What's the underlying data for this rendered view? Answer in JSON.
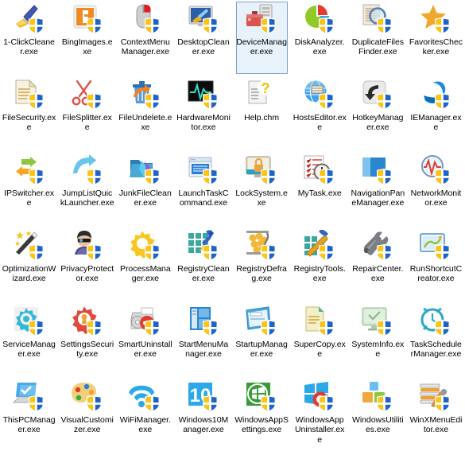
{
  "window": {
    "view": "large-icons-file-grid",
    "background_color": "#ffffff",
    "label_color": "#000000",
    "selection_border_color": "#7da2ce",
    "selection_fill_color": "#e8f2fb",
    "columns": 8,
    "rows": 6,
    "item_count": 48
  },
  "items": [
    {
      "name": "1-ClickCleaner.exe",
      "icon": "broom-brush-icon",
      "shield": true
    },
    {
      "name": "BingImages.exe",
      "icon": "bing-b-icon",
      "shield": true
    },
    {
      "name": "ContextMenuManager.exe",
      "icon": "mouse-icon",
      "shield": true
    },
    {
      "name": "DesktopCleaner.exe",
      "icon": "desktop-broom-icon",
      "shield": true
    },
    {
      "name": "DeviceManager.exe",
      "icon": "toolbox-device-icon",
      "shield": true,
      "selected": true
    },
    {
      "name": "DiskAnalyzer.exe",
      "icon": "pie-chart-icon",
      "shield": true
    },
    {
      "name": "DuplicateFilesFinder.exe",
      "icon": "documents-magnifier-icon",
      "shield": true
    },
    {
      "name": "FavoritesChecker.exe",
      "icon": "star-icon",
      "shield": true
    },
    {
      "name": "FileSecurity.exe",
      "icon": "document-lines-icon",
      "shield": true
    },
    {
      "name": "FileSplitter.exe",
      "icon": "scissors-icon",
      "shield": true
    },
    {
      "name": "FileUndelete.exe",
      "icon": "trash-undo-icon",
      "shield": true
    },
    {
      "name": "HardwareMonitor.exe",
      "icon": "heartbeat-screen-icon",
      "shield": true
    },
    {
      "name": "Help.chm",
      "icon": "help-question-document-icon",
      "shield": false
    },
    {
      "name": "HostsEditor.exe",
      "icon": "globe-hosts-icon",
      "shield": true
    },
    {
      "name": "HotkeyManager.exe",
      "icon": "hotkey-arrow-icon",
      "shield": true
    },
    {
      "name": "IEManager.exe",
      "icon": "internet-explorer-e-icon",
      "shield": true
    },
    {
      "name": "IPSwitcher.exe",
      "icon": "two-arrows-swap-icon",
      "shield": true
    },
    {
      "name": "JumpListQuickLauncher.exe",
      "icon": "curved-arrow-icon",
      "shield": true
    },
    {
      "name": "JunkFileCleaner.exe",
      "icon": "folder-junk-icon",
      "shield": true
    },
    {
      "name": "LaunchTaskCommand.exe",
      "icon": "window-panel-icon",
      "shield": true
    },
    {
      "name": "LockSystem.exe",
      "icon": "monitor-lock-icon",
      "shield": true
    },
    {
      "name": "MyTask.exe",
      "icon": "checklist-clock-icon",
      "shield": true
    },
    {
      "name": "NavigationPaneManager.exe",
      "icon": "nav-pane-icon",
      "shield": true
    },
    {
      "name": "NetworkMonitor.exe",
      "icon": "network-pulse-icon",
      "shield": true
    },
    {
      "name": "OptimizationWizard.exe",
      "icon": "magic-wand-icon",
      "shield": true
    },
    {
      "name": "PrivacyProtector.exe",
      "icon": "spy-person-icon",
      "shield": true
    },
    {
      "name": "ProcessManager.exe",
      "icon": "yellow-gear-icon",
      "shield": true
    },
    {
      "name": "RegistryCleaner.exe",
      "icon": "registry-grid-brush-icon",
      "shield": true
    },
    {
      "name": "RegistryDefrag.exe",
      "icon": "registry-compress-icon",
      "shield": true
    },
    {
      "name": "RegistryTools.exe",
      "icon": "registry-wrench-icon",
      "shield": true
    },
    {
      "name": "RepairCenter.exe",
      "icon": "screwdriver-wrench-icon",
      "shield": true
    },
    {
      "name": "RunShortcutCreator.exe",
      "icon": "shortcut-frame-icon",
      "shield": true
    },
    {
      "name": "ServiceManager.exe",
      "icon": "cyan-gear-icon",
      "shield": true
    },
    {
      "name": "SettingsSecurity.exe",
      "icon": "red-gear-lock-icon",
      "shield": true
    },
    {
      "name": "SmartUninstaller.exe",
      "icon": "uninstall-disc-icon",
      "shield": true
    },
    {
      "name": "StartMenuManager.exe",
      "icon": "start-menu-panel-icon",
      "shield": true
    },
    {
      "name": "StartupManager.exe",
      "icon": "startup-window-icon",
      "shield": true
    },
    {
      "name": "SuperCopy.exe",
      "icon": "copy-pages-icon",
      "shield": true
    },
    {
      "name": "SystemInfo.exe",
      "icon": "monitor-check-icon",
      "shield": true
    },
    {
      "name": "TaskSchedulerManager.exe",
      "icon": "alarm-clock-icon",
      "shield": true
    },
    {
      "name": "ThisPCManager.exe",
      "icon": "pc-check-icon",
      "shield": true
    },
    {
      "name": "VisualCustomizer.exe",
      "icon": "paint-palette-icon",
      "shield": true
    },
    {
      "name": "WiFiManager.exe",
      "icon": "wifi-icon",
      "shield": true
    },
    {
      "name": "Windows10Manager.exe",
      "icon": "windows-10-icon",
      "shield": true
    },
    {
      "name": "WindowsAppSettings.exe",
      "icon": "windows-green-badge-icon",
      "shield": true
    },
    {
      "name": "WindowsAppUninstaller.exe",
      "icon": "windows-logo-uninstall-icon",
      "shield": true
    },
    {
      "name": "WindowsUtilities.exe",
      "icon": "blocks-utilities-icon",
      "shield": true
    },
    {
      "name": "WinXMenuEditor.exe",
      "icon": "menu-list-wrench-icon",
      "shield": true
    }
  ]
}
